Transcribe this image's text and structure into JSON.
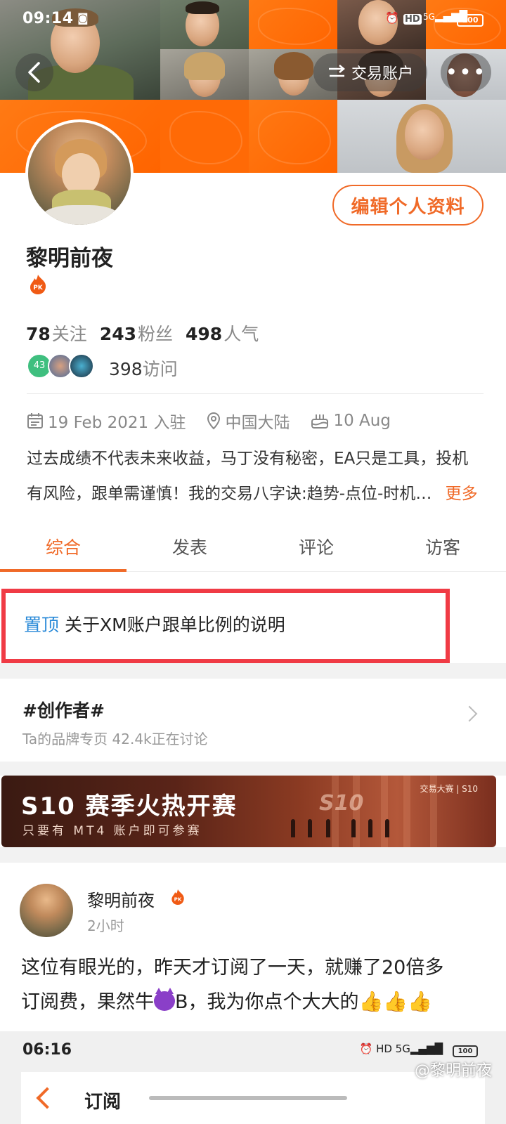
{
  "status_bar": {
    "time": "09:14",
    "hd": "HD",
    "network": "5G",
    "battery": "100"
  },
  "header": {
    "swap_label": "交易账户",
    "more_label": "•••"
  },
  "profile": {
    "edit_label": "编辑个人资料",
    "username": "黎明前夜",
    "pk_badge": "PK",
    "stats": [
      {
        "num": "78",
        "label": "关注"
      },
      {
        "num": "243",
        "label": "粉丝"
      },
      {
        "num": "498",
        "label": "人气"
      }
    ],
    "visitor_badge": "43",
    "visits_num": "398",
    "visits_label": "访问",
    "joined": "19 Feb 2021 入驻",
    "location": "中国大陆",
    "birthday": "10 Aug",
    "bio_line1": "过去成绩不代表未来收益，马丁没有秘密，EA只是工具，投机",
    "bio_line2": "有风险，跟单需谨慎！我的交易八字诀:趋势-点位-时机…",
    "bio_more": "更多"
  },
  "tabs": [
    {
      "label": "综合",
      "active": true
    },
    {
      "label": "发表",
      "active": false
    },
    {
      "label": "评论",
      "active": false
    },
    {
      "label": "访客",
      "active": false
    }
  ],
  "pinned": {
    "tag": "置顶",
    "title": "关于XM账户跟单比例的说明"
  },
  "creator": {
    "title": "#创作者#",
    "subtitle": "Ta的品牌专页  42.4k正在讨论"
  },
  "banner": {
    "title": "S10 赛季火热开赛",
    "subtitle": "只要有 MT4 账户即可参赛",
    "brand": "交易大赛 | S10",
    "badge": "S10"
  },
  "post": {
    "author": "黎明前夜",
    "time": "2小时",
    "line1": "这位有眼光的，昨天才订阅了一天，就赚了20倍多",
    "line2_pre": "订阅费，果然牛",
    "line2_post": "B，我为你点个大大的",
    "thumbs": "👍👍👍"
  },
  "embedded": {
    "time": "06:16",
    "title": "订阅",
    "battery": "100"
  },
  "watermark": "@黎明前夜",
  "colors": {
    "accent": "#f06a28",
    "pinned_border": "#f03b45",
    "pinned_tag": "#2a8ad8"
  }
}
